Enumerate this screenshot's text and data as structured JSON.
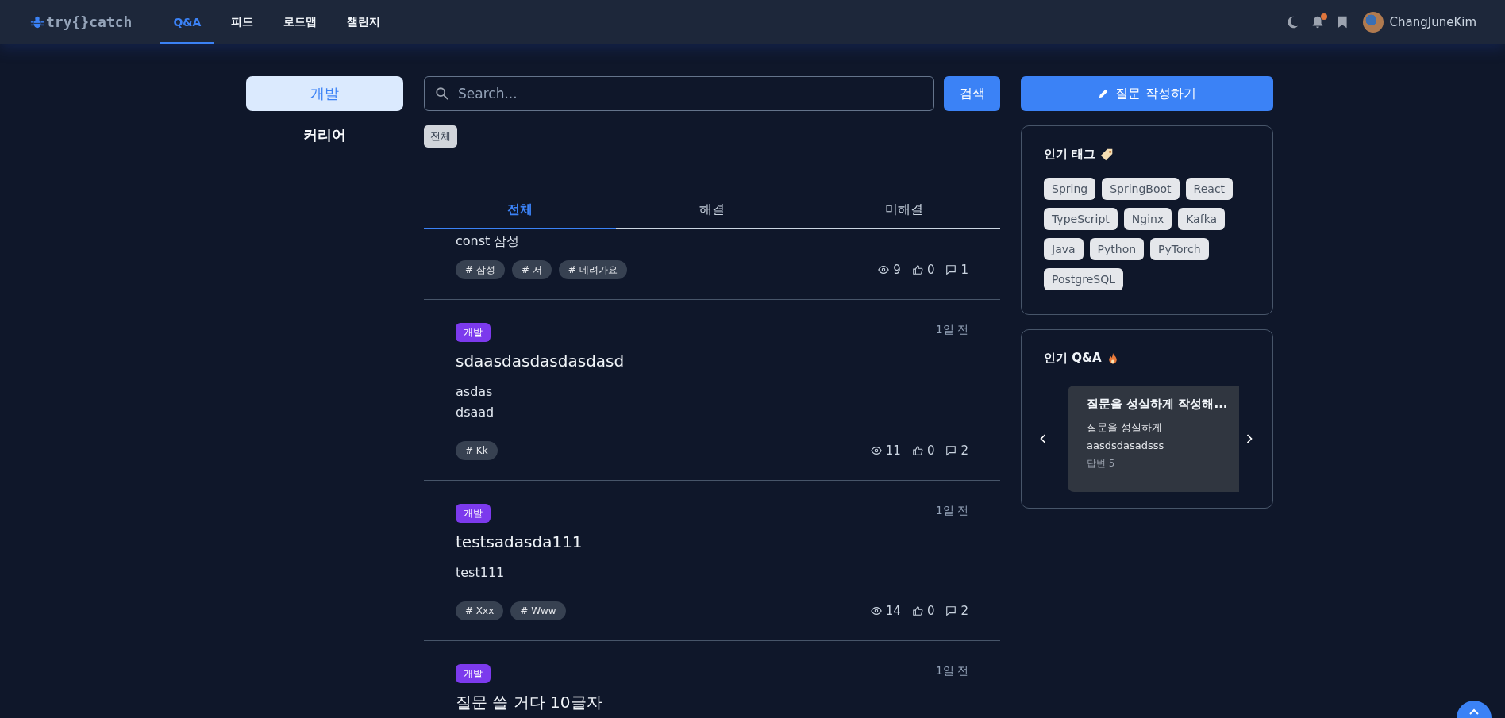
{
  "header": {
    "logo": "try{}catch",
    "nav": [
      {
        "label": "Q&A",
        "selected": true
      },
      {
        "label": "피드",
        "selected": false
      },
      {
        "label": "로드맵",
        "selected": false
      },
      {
        "label": "챌린지",
        "selected": false
      }
    ],
    "notification": true,
    "user": "ChangJuneKim"
  },
  "sidebar": {
    "items": [
      {
        "label": "개발",
        "selected": true
      },
      {
        "label": "커리어",
        "selected": false
      }
    ]
  },
  "search": {
    "placeholder": "Search...",
    "button": "검색"
  },
  "filter_chip": "전체",
  "tabs": [
    {
      "label": "전체",
      "selected": true
    },
    {
      "label": "해결",
      "selected": false
    },
    {
      "label": "미해결",
      "selected": false
    }
  ],
  "posts": [
    {
      "body": [
        "const 삼성"
      ],
      "tags": [
        "# 삼성",
        "# 저",
        "# 데려가요"
      ],
      "views": "9",
      "likes": "0",
      "comments": "1"
    },
    {
      "category": "개발",
      "date": "1일 전",
      "title": "sdaasdasdasdasdasd",
      "body": [
        "asdas",
        "dsaad"
      ],
      "tags": [
        "# Kk"
      ],
      "views": "11",
      "likes": "0",
      "comments": "2"
    },
    {
      "category": "개발",
      "date": "1일 전",
      "title": "testsadasda111",
      "body": [
        "test111"
      ],
      "tags": [
        "# Xxx",
        "# Www"
      ],
      "views": "14",
      "likes": "0",
      "comments": "2"
    },
    {
      "category": "개발",
      "date": "1일 전",
      "title": "질문 쓸 거다 10글자"
    }
  ],
  "write_button": "질문 작성하기",
  "popular_tags": {
    "title": "인기 태그",
    "tags": [
      "Spring",
      "SpringBoot",
      "React",
      "TypeScript",
      "Nginx",
      "Kafka",
      "Java",
      "Python",
      "PyTorch",
      "PostgreSQL"
    ]
  },
  "popular_qna": {
    "title": "인기 Q&A",
    "card": {
      "title": "질문을 성실하게 작성해...",
      "body": [
        "질문을 성실하게",
        "aasdsdasadsss"
      ],
      "answers": "답변 5"
    }
  }
}
